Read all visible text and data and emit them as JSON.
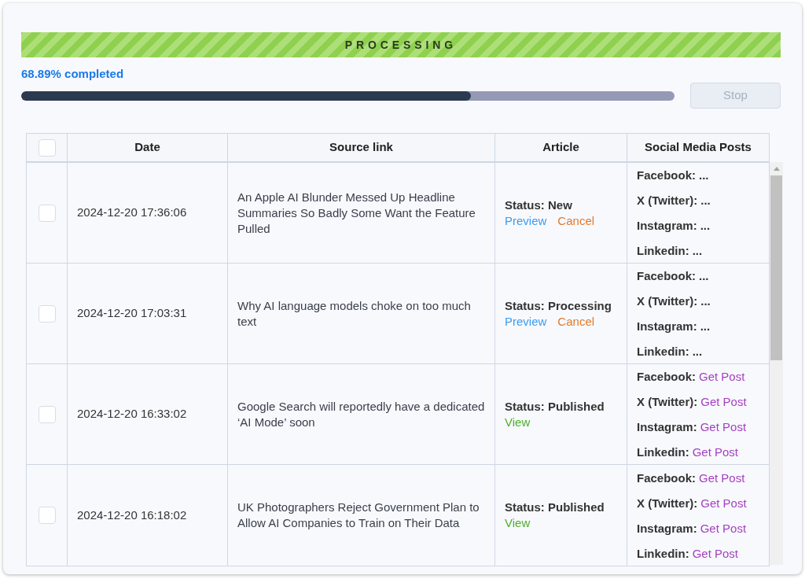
{
  "banner": {
    "label": "PROCESSING"
  },
  "progress": {
    "label": "68.89% completed",
    "level": 0.6889
  },
  "stop_button": {
    "label": "Stop",
    "disabled": true
  },
  "table": {
    "select_all": {
      "checked": false
    },
    "columns": [
      "Date",
      "Source link",
      "Article",
      "Social Media Posts"
    ],
    "rows": [
      {
        "checked": false,
        "date": "2024-12-20 17:36:06",
        "source": "An Apple AI Blunder Messed Up Headline Summaries So Badly Some Want the Feature Pulled",
        "status": "Status: New",
        "actions": [
          {
            "kind": "preview",
            "label": "Preview"
          },
          {
            "kind": "cancel",
            "label": "Cancel"
          }
        ],
        "posts": [
          {
            "platform": "Facebook:",
            "value": "...",
            "kind": "pending"
          },
          {
            "platform": "X (Twitter):",
            "value": "...",
            "kind": "pending"
          },
          {
            "platform": "Instagram:",
            "value": "...",
            "kind": "pending"
          },
          {
            "platform": "Linkedin:",
            "value": "...",
            "kind": "pending"
          }
        ]
      },
      {
        "checked": false,
        "date": "2024-12-20 17:03:31",
        "source": "Why AI language models choke on too much text",
        "status": "Status: Processing",
        "actions": [
          {
            "kind": "preview",
            "label": "Preview"
          },
          {
            "kind": "cancel",
            "label": "Cancel"
          }
        ],
        "posts": [
          {
            "platform": "Facebook:",
            "value": "...",
            "kind": "pending"
          },
          {
            "platform": "X (Twitter):",
            "value": "...",
            "kind": "pending"
          },
          {
            "platform": "Instagram:",
            "value": "...",
            "kind": "pending"
          },
          {
            "platform": "Linkedin:",
            "value": "...",
            "kind": "pending"
          }
        ]
      },
      {
        "checked": false,
        "date": "2024-12-20 16:33:02",
        "source": "Google Search will reportedly have a dedicated ‘AI Mode’ soon",
        "status": "Status: Published",
        "actions": [
          {
            "kind": "view",
            "label": "View"
          }
        ],
        "posts": [
          {
            "platform": "Facebook:",
            "value": "Get Post",
            "kind": "link"
          },
          {
            "platform": "X (Twitter):",
            "value": "Get Post",
            "kind": "link"
          },
          {
            "platform": "Instagram:",
            "value": "Get Post",
            "kind": "link"
          },
          {
            "platform": "Linkedin:",
            "value": "Get Post",
            "kind": "link"
          }
        ]
      },
      {
        "checked": false,
        "date": "2024-12-20 16:18:02",
        "source": "UK Photographers Reject Government Plan to Allow AI Companies to Train on Their Data",
        "status": "Status: Published",
        "actions": [
          {
            "kind": "view",
            "label": "View"
          }
        ],
        "posts": [
          {
            "platform": "Facebook:",
            "value": "Get Post",
            "kind": "link"
          },
          {
            "platform": "X (Twitter):",
            "value": "Get Post",
            "kind": "link"
          },
          {
            "platform": "Instagram:",
            "value": "Get Post",
            "kind": "link"
          },
          {
            "platform": "Linkedin:",
            "value": "Get Post",
            "kind": "link"
          }
        ]
      }
    ]
  }
}
